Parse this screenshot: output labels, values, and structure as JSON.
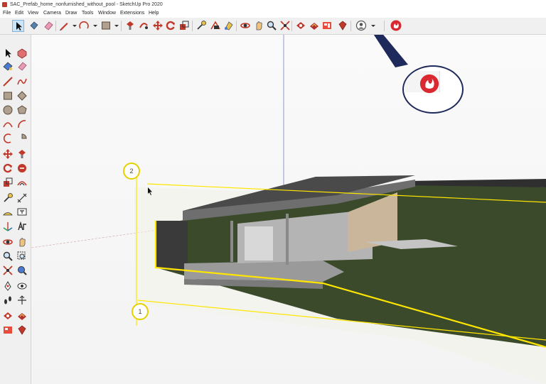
{
  "window": {
    "title": "SAC_Prefab_home_nonfurnished_without_pool - SketchUp Pro 2020"
  },
  "menu": {
    "items": [
      "File",
      "Edit",
      "View",
      "Camera",
      "Draw",
      "Tools",
      "Window",
      "Extensions",
      "Help"
    ]
  },
  "toolbar": {
    "icons": [
      "select-icon",
      "eraser-icon",
      "paint-bucket-icon",
      "pencil-icon",
      "dropdown-icon",
      "arc-icon",
      "dropdown-icon",
      "rectangle-icon",
      "dropdown-icon",
      "push-pull-icon",
      "follow-me-icon",
      "move-icon",
      "rotate-icon",
      "scale-icon",
      "tape-measure-icon",
      "text-icon",
      "paint-icon",
      "orbit-icon",
      "pan-icon",
      "zoom-icon",
      "zoom-extents-icon",
      "warehouse-icon",
      "extension-warehouse-icon",
      "layout-icon",
      "ruby-icon",
      "profile-icon",
      "dropdown-icon",
      "extension-plugin-icon"
    ]
  },
  "colors": {
    "accent": "#d9282f",
    "selection": "#ffe600",
    "grass": "#3b4a2b",
    "roof": "#595959",
    "callout_border": "#1f2a5c"
  },
  "viewport": {
    "section_markers": [
      "2",
      "1"
    ]
  }
}
